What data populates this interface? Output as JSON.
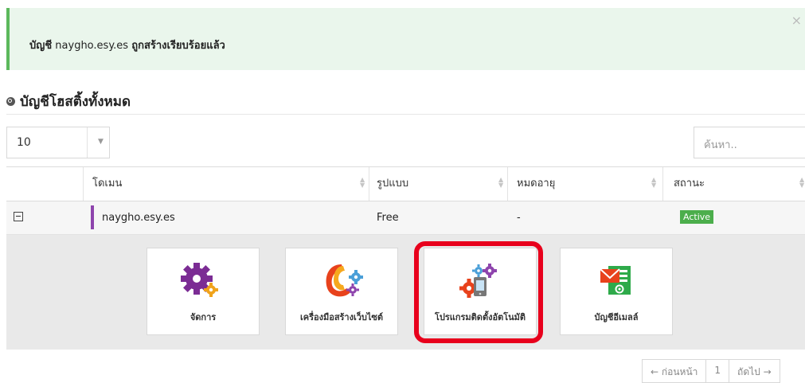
{
  "alert": {
    "prefix": "บัญชี",
    "domain": "naygho.esy.es",
    "suffix": "ถูกสร้างเรียบร้อยแล้ว",
    "close": "×"
  },
  "section": {
    "title": "บัญชีโฮสติ้งทั้งหมด"
  },
  "table_controls": {
    "page_length": "10",
    "search_placeholder": "ค้นหา.."
  },
  "table": {
    "headers": [
      "โดเมน",
      "รูปแบบ",
      "หมดอายุ",
      "สถานะ"
    ],
    "rows": [
      {
        "domain": "naygho.esy.es",
        "plan": "Free",
        "expires": "-",
        "status": "Active"
      }
    ]
  },
  "tools": [
    {
      "label": "จัดการ",
      "icon": "gears-icon"
    },
    {
      "label": "เครื่องมือสร้างเว็บไซต์",
      "icon": "website-builder-icon"
    },
    {
      "label": "โปรแกรมติดตั้งอัตโนมัติ",
      "icon": "auto-installer-icon"
    },
    {
      "label": "บัญชีอีเมลล์",
      "icon": "email-accounts-icon"
    }
  ],
  "pagination": {
    "prev": "← ก่อนหน้า",
    "current": "1",
    "next": "ถัดไป →"
  },
  "colors": {
    "alert_bg": "#eaf6ec",
    "alert_border": "#5cb85c",
    "active_badge": "#4cae4c",
    "highlight": "#e8001c",
    "domain_bar": "#8e44ad"
  }
}
